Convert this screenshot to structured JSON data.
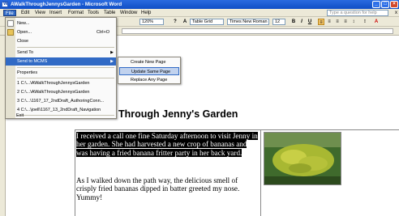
{
  "window": {
    "title": "AWalkThroughJennysGarden - Microsoft Word"
  },
  "menubar": {
    "items": [
      "File",
      "Edit",
      "View",
      "Insert",
      "Format",
      "Tools",
      "Table",
      "Window",
      "Help"
    ],
    "ask_placeholder": "Type a question for help",
    "close_doc": "x"
  },
  "toolbar": {
    "zoom": "120%",
    "style": "Table Grid",
    "font": "Times New Roman",
    "size": "12"
  },
  "file_menu": {
    "items": [
      {
        "label": "New...",
        "shortcut": ""
      },
      {
        "label": "Open...",
        "shortcut": "Ctrl+O"
      },
      {
        "label": "Close",
        "shortcut": ""
      },
      {
        "label": "Send To",
        "shortcut": ""
      },
      {
        "label": "Send to MCMS",
        "shortcut": ""
      },
      {
        "label": "Properties",
        "shortcut": ""
      },
      {
        "label": "1 C:\\...\\AWalkThroughJennysGarden",
        "shortcut": ""
      },
      {
        "label": "2 C:\\...\\AWalkThroughJennysGarden",
        "shortcut": ""
      },
      {
        "label": "3 C:\\...\\1167_17_2ndDraft_AuthoringConn...",
        "shortcut": ""
      },
      {
        "label": "4 C:\\...\\joell\\1167_13_2ndDraft_Navigation",
        "shortcut": ""
      },
      {
        "label": "Exit",
        "shortcut": ""
      }
    ]
  },
  "submenu": {
    "items": [
      "Create New Page",
      "Update Same Page",
      "Replace Any Page"
    ]
  },
  "document": {
    "heading": "Through Jenny's Garden",
    "para1": "I received a call one fine Saturday afternoon to visit Jenny in her garden. She had harvested a new crop of bananas and was having a fried banana fritter party in her back yard.",
    "para2": "As I walked down the path way, the delicious smell of crisply fried bananas dipped in batter greeted my nose. Yummy!"
  }
}
